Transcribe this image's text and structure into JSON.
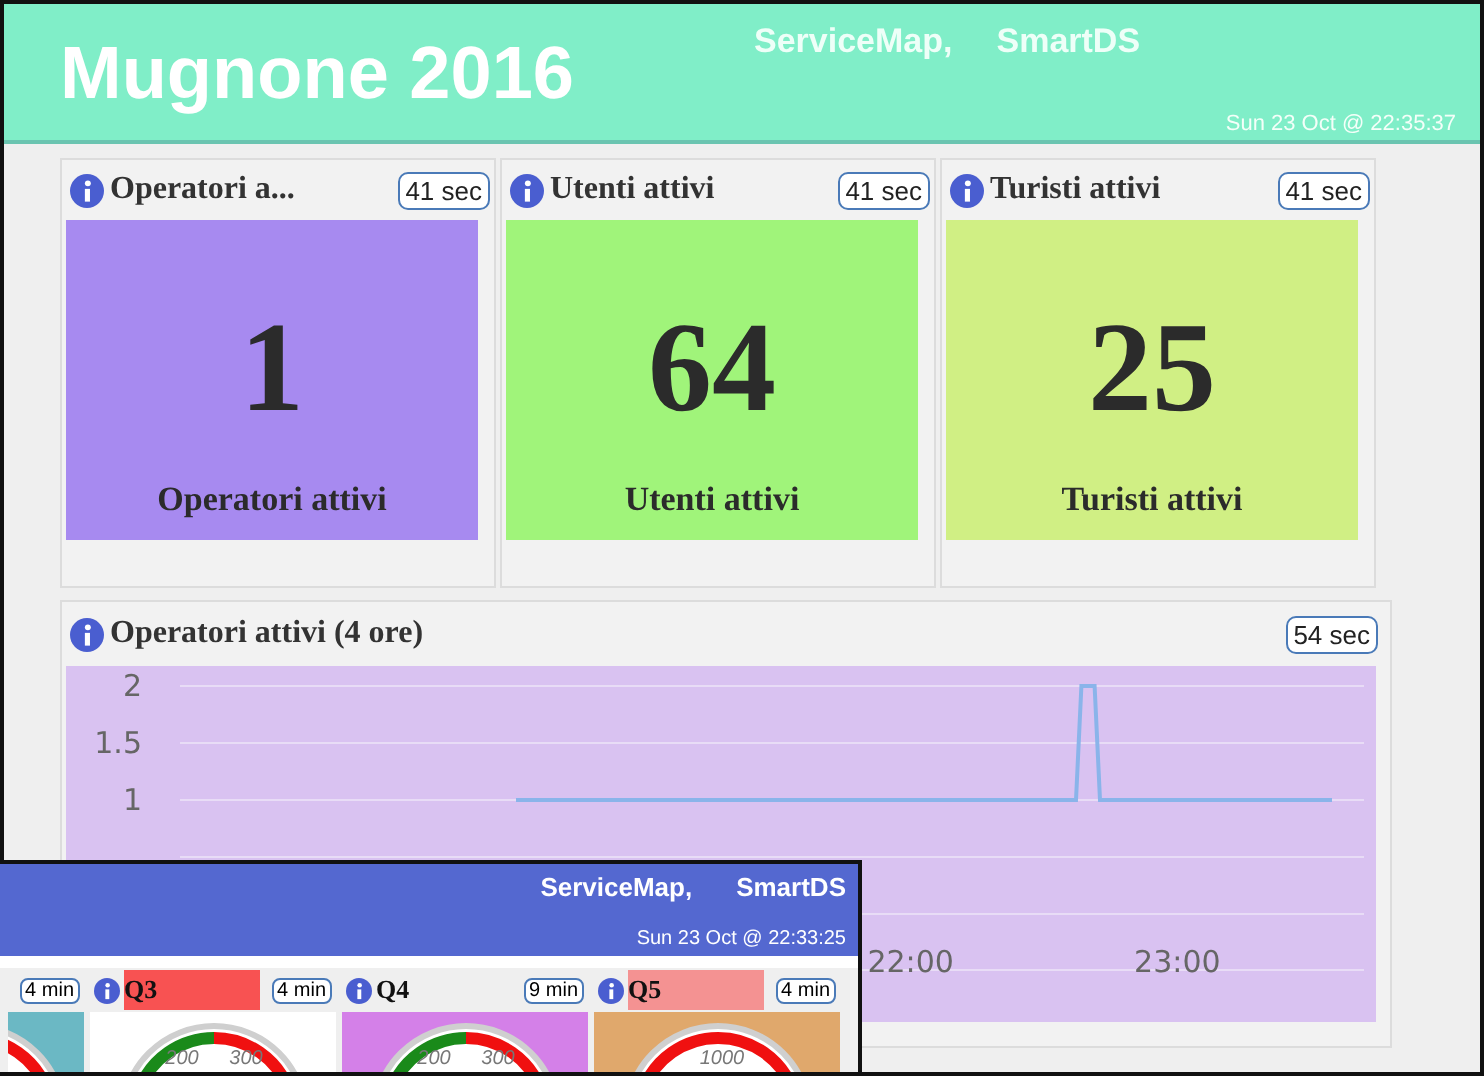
{
  "window": {
    "title": "Mugnone 2016",
    "links": [
      "ServiceMap,",
      "SmartDS"
    ],
    "timestamp": "Sun 23 Oct @ 22:35:37"
  },
  "widgets": [
    {
      "title": "Operatori a...",
      "badge": "41 sec",
      "value": "1",
      "caption": "Operatori attivi",
      "color": "#a78af0"
    },
    {
      "title": "Utenti attivi",
      "badge": "41 sec",
      "value": "64",
      "caption": "Utenti attivi",
      "color": "#a0f47a"
    },
    {
      "title": "Turisti attivi",
      "badge": "41 sec",
      "value": "25",
      "caption": "Turisti attivi",
      "color": "#d0ef84"
    }
  ],
  "chart_widget": {
    "title": "Operatori attivi (4 ore)",
    "badge": "54 sec",
    "chart_data": {
      "type": "line",
      "xlim": [
        19.26,
        23.7
      ],
      "ylim": [
        0,
        2
      ],
      "yticks": [
        1,
        1.5,
        2
      ],
      "xticks": [
        {
          "value": 22,
          "label": "22:00"
        },
        {
          "value": 23,
          "label": "23:00"
        }
      ],
      "x": [
        20.52,
        22.62,
        22.64,
        22.69,
        22.71,
        23.58
      ],
      "series": [
        {
          "color": "#8ab4ea",
          "values": [
            1,
            1,
            2,
            2,
            1,
            1
          ]
        }
      ]
    }
  },
  "overlay_window": {
    "links": [
      "ServiceMap,",
      "SmartDS"
    ],
    "timestamp": "Sun 23 Oct @ 22:33:25",
    "widgets": [
      {
        "kind": "partial",
        "badge": "4 min",
        "color": "#6bb8c4",
        "arc_segments": [
          {
            "color": "#f01010"
          }
        ]
      },
      {
        "kind": "gauge",
        "title": "Q3",
        "title_tag": {
          "color": "#f85252"
        },
        "badge": "4 min",
        "color": "#ffffff",
        "arc_segments": [
          {
            "color": "#1a8a1a"
          },
          {
            "color": "#f01010"
          }
        ],
        "gauge_labels": [
          "200",
          "300"
        ]
      },
      {
        "kind": "gauge",
        "title": "Q4",
        "badge": "9 min",
        "color": "#d480e8",
        "arc_segments": [
          {
            "color": "#1a8a1a"
          },
          {
            "color": "#f01010"
          }
        ],
        "gauge_labels": [
          "200",
          "300"
        ]
      },
      {
        "kind": "gauge",
        "title": "Q5",
        "title_tag": {
          "color": "#f49292"
        },
        "badge": "4 min",
        "color": "#e0a86c",
        "arc_segments": [
          {
            "color": "#f01010"
          }
        ],
        "gauge_labels": [
          "1000"
        ]
      }
    ]
  }
}
